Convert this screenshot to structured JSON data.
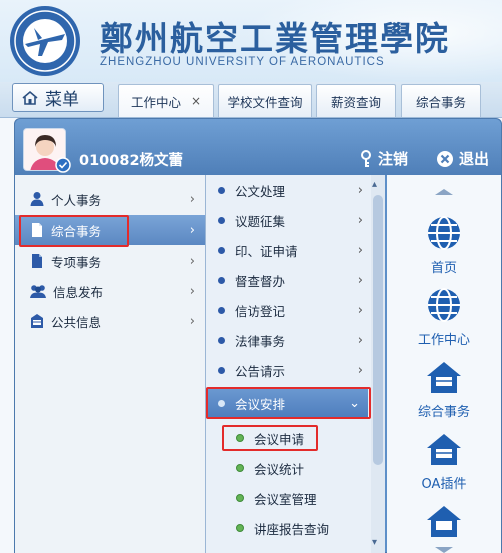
{
  "header": {
    "title_cn": "鄭州航空工業管理學院",
    "title_en": "ZHENGZHOU UNIVERSITY OF AERONAUTICS"
  },
  "tabbar": {
    "menu_label": "菜单",
    "tabs": [
      {
        "label": "工作中心",
        "close": "×"
      },
      {
        "label": "学校文件查询"
      },
      {
        "label": "薪资查询"
      },
      {
        "label": "综合事务"
      }
    ]
  },
  "user": {
    "name": "010082杨文蕾",
    "logout_label": "注销",
    "exit_label": "退出"
  },
  "menu_l1": [
    {
      "label": "个人事务",
      "icon": "person-icon"
    },
    {
      "label": "综合事务",
      "icon": "document-icon",
      "active": true
    },
    {
      "label": "专项事务",
      "icon": "file-icon"
    },
    {
      "label": "信息发布",
      "icon": "group-icon"
    },
    {
      "label": "公共信息",
      "icon": "inbox-icon"
    }
  ],
  "menu_l2": [
    {
      "label": "公文处理"
    },
    {
      "label": "议题征集"
    },
    {
      "label": "印、证申请"
    },
    {
      "label": "督查督办"
    },
    {
      "label": "信访登记"
    },
    {
      "label": "法律事务"
    },
    {
      "label": "公告请示"
    },
    {
      "label": "会议安排",
      "active": true
    }
  ],
  "menu_l3": [
    {
      "label": "会议申请"
    },
    {
      "label": "会议统计"
    },
    {
      "label": "会议室管理"
    },
    {
      "label": "讲座报告查询"
    }
  ],
  "quick_links": [
    {
      "label": "首页"
    },
    {
      "label": "工作中心"
    },
    {
      "label": "综合事务"
    },
    {
      "label": "OA插件"
    }
  ],
  "colors": {
    "highlight_red": "#e32b2b",
    "menu_blue": "#5b88c2",
    "link_blue": "#1f5fb0"
  }
}
